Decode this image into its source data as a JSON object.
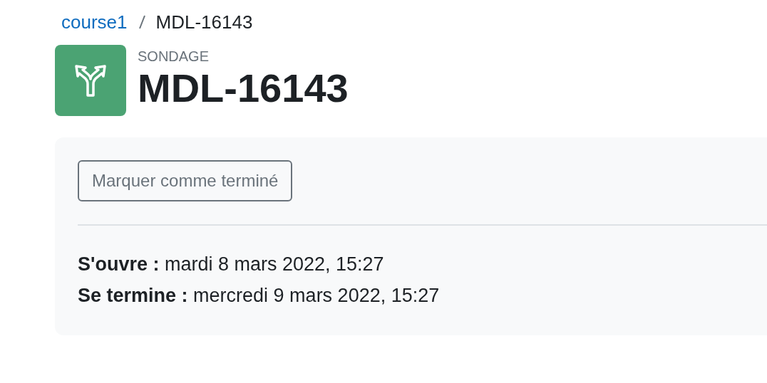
{
  "breadcrumb": [
    {
      "label": "course1",
      "kind": "link"
    },
    {
      "label": "MDL-16143",
      "kind": "current"
    }
  ],
  "header": {
    "module_type": "SONDAGE",
    "title": "MDL-16143"
  },
  "completion_button": {
    "label": "Marquer comme terminé"
  },
  "dates": [
    {
      "label": "S'ouvre :",
      "value": "mardi 8 mars 2022, 15:27"
    },
    {
      "label": "Se termine :",
      "value": "mercredi 9 mars 2022, 15:27"
    }
  ]
}
